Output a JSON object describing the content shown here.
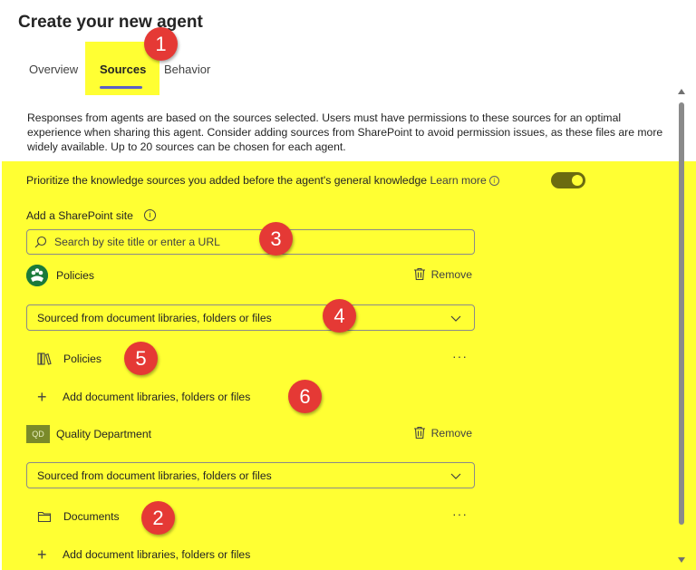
{
  "page": {
    "title": "Create your new agent"
  },
  "tabs": [
    {
      "label": "Overview"
    },
    {
      "label": "Sources"
    },
    {
      "label": "Behavior"
    }
  ],
  "description": "Responses from agents are based on the sources selected. Users must have permissions to these sources for an optimal experience when sharing this agent. Consider adding sources from SharePoint to avoid permission issues, as these files are more widely available. Up to 20 sources can be chosen for each agent.",
  "prioritize": {
    "label": "Prioritize the knowledge sources you added before the agent's general knowledge",
    "learn_more": "Learn more",
    "toggle_on": true
  },
  "sharepoint": {
    "label": "Add a SharePoint site",
    "search_placeholder": "Search by site title or enter a URL"
  },
  "sites": [
    {
      "name": "Policies",
      "avatar": "",
      "remove_label": "Remove",
      "dropdown": "Sourced from document libraries, folders or files",
      "items": [
        {
          "name": "Policies",
          "icon": "library-icon",
          "more": "···"
        }
      ],
      "add_label": "Add document libraries, folders or files"
    },
    {
      "name": "Quality Department",
      "avatar": "QD",
      "remove_label": "Remove",
      "dropdown": "Sourced from document libraries, folders or files",
      "items": [
        {
          "name": "Documents",
          "icon": "folder-icon",
          "more": "···"
        }
      ],
      "add_label": "Add document libraries, folders or files"
    }
  ],
  "badges": [
    "1",
    "2",
    "3",
    "4",
    "5",
    "6"
  ],
  "colors": {
    "highlight": "#ffff33",
    "badge": "#e53935",
    "accent": "#5b5fc7",
    "toggle": "#6b6b10"
  }
}
